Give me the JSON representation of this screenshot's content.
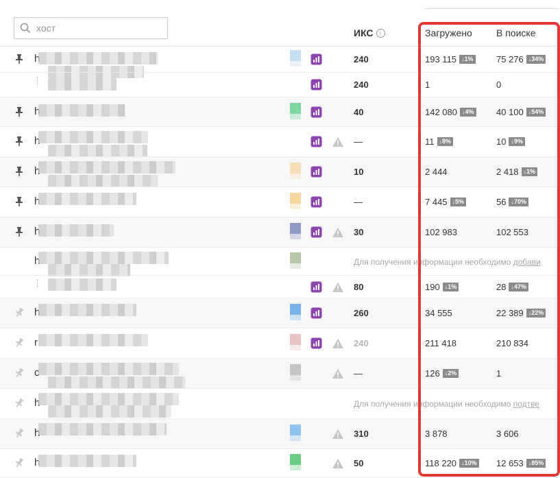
{
  "search": {
    "placeholder": "хост"
  },
  "columns": {
    "iks": "ИКС",
    "iks_info": "i",
    "loaded": "Загружено",
    "in_search": "В поиске"
  },
  "colors": {
    "highlight": "#e53935",
    "metrika": "#8e44ad",
    "badge": "#8a8a8a"
  },
  "rows": [
    {
      "pin": "dark",
      "letter": "h",
      "color": "#c5dff2",
      "metrika": true,
      "warn": false,
      "iks": "240",
      "loaded": "193 115",
      "loaded_badge": "↓1%",
      "search": "75 276",
      "search_badge": "↓34%"
    },
    {
      "sub": true,
      "metrika": true,
      "iks": "240",
      "loaded": "1",
      "search": "0"
    },
    {
      "pin": "dark",
      "letter": "h",
      "color": "#7ed6a0",
      "metrika": true,
      "warn": false,
      "iks": "40",
      "loaded": "142 080",
      "loaded_badge": "↓4%",
      "search": "40 100",
      "search_badge": "↓54%"
    },
    {
      "pin": "dark",
      "letter": "h",
      "metrika": true,
      "warn": true,
      "iks": "—",
      "loaded": "11",
      "loaded_badge": "↓8%",
      "search": "10",
      "search_badge": "↓9%"
    },
    {
      "pin": "dark",
      "letter": "h",
      "color": "#f7deb4",
      "metrika": true,
      "warn": false,
      "iks": "10",
      "loaded": "2 444",
      "search": "2 418",
      "search_badge": "↓1%"
    },
    {
      "pin": "dark",
      "letter": "h",
      "color": "#f8d59c",
      "metrika": true,
      "warn": false,
      "iks": "—",
      "loaded": "7 445",
      "loaded_badge": "↓5%",
      "search": "56",
      "search_badge": "↓70%"
    },
    {
      "pin": "dark",
      "letter": "h",
      "color": "#8e9cc5",
      "metrika": true,
      "warn": true,
      "iks": "30",
      "loaded": "102 983",
      "search": "102 553"
    },
    {
      "letter": "h",
      "color": "#b7c7a8",
      "message": "Для получения информации необходимо ",
      "message_link": "добави"
    },
    {
      "sub": true,
      "metrika": true,
      "warn": true,
      "iks": "80",
      "loaded": "190",
      "loaded_badge": "↓1%",
      "search": "28",
      "search_badge": "↓47%"
    },
    {
      "pin": "light",
      "letter": "h",
      "color": "#78b4ea",
      "metrika": true,
      "warn": false,
      "iks": "260",
      "loaded": "34 555",
      "search": "22 389",
      "search_badge": "↓22%"
    },
    {
      "pin": "light",
      "letter": "r",
      "color": "#e8c3c3",
      "metrika": true,
      "warn": true,
      "iks": "240",
      "iks_muted": true,
      "loaded": "211 418",
      "search": "210 834"
    },
    {
      "pin": "light",
      "letter": "c",
      "color": "#c4c4c4",
      "metrika": false,
      "warn": true,
      "iks": "—",
      "loaded": "126",
      "loaded_badge": "↓2%",
      "search": "1"
    },
    {
      "pin": "light",
      "letter": "h",
      "message": "Для получения информации необходимо ",
      "message_link": "подтве"
    },
    {
      "pin": "light",
      "letter": "h",
      "color": "#8fc2ee",
      "metrika": false,
      "warn": true,
      "iks": "310",
      "loaded": "3 878",
      "search": "3 606"
    },
    {
      "pin": "light",
      "letter": "h",
      "color": "#6ccc84",
      "metrika": false,
      "warn": true,
      "iks": "50",
      "loaded": "118 220",
      "loaded_badge": "↓10%",
      "search": "12 653",
      "search_badge": "↓85%"
    }
  ]
}
